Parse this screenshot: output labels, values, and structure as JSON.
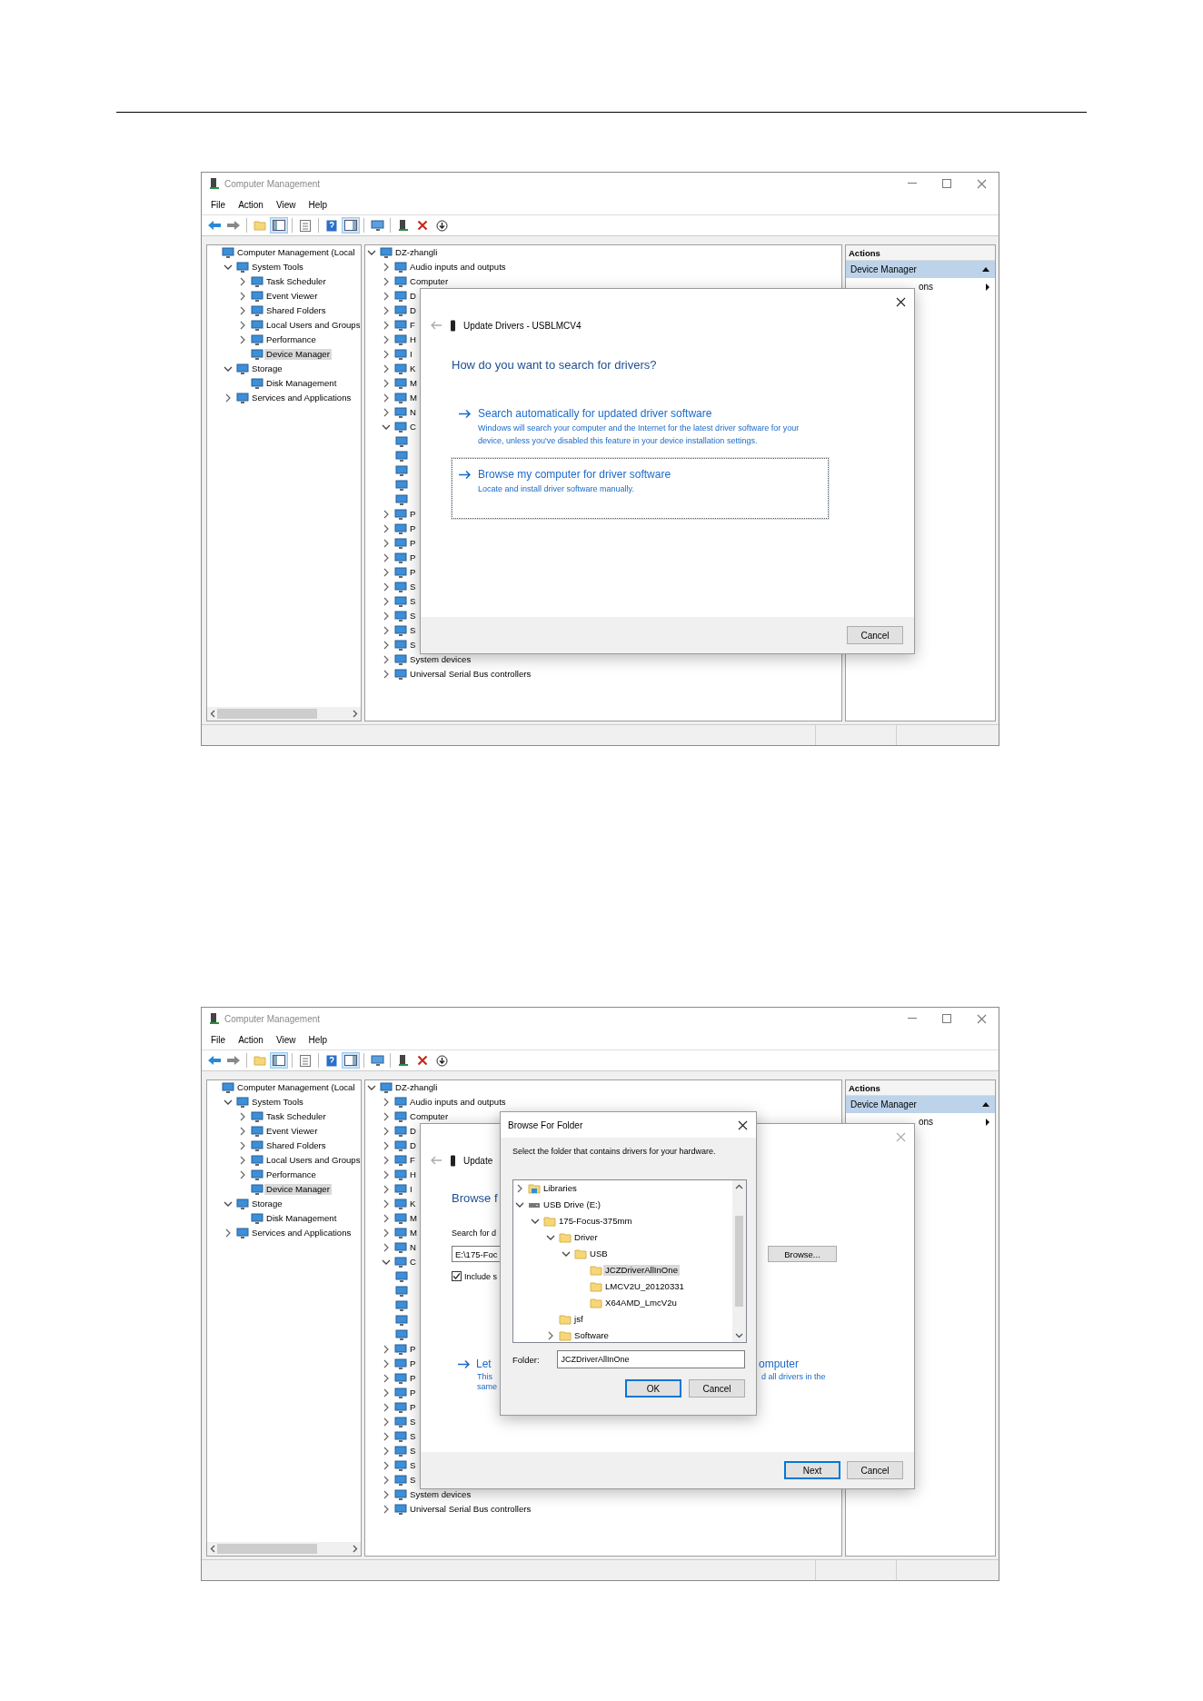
{
  "screenshots": [
    {
      "window": {
        "title": "Computer Management",
        "menu": [
          "File",
          "Action",
          "View",
          "Help"
        ],
        "toolbar": [
          {
            "pressed": false
          },
          {
            "pressed": false
          },
          {
            "pressed": false
          },
          {
            "pressed": true
          },
          {
            "pressed": false
          },
          {
            "pressed": false
          },
          {
            "pressed": true
          },
          {
            "pressed": false
          },
          {
            "pressed": false
          },
          {
            "pressed": false
          },
          {
            "pressed": false
          }
        ],
        "nav_tree": [
          {
            "label": "Computer Management (Local",
            "selected": false,
            "children": [
              {
                "label": "System Tools",
                "expanded": true,
                "selected": false,
                "children": [
                  {
                    "label": "Task Scheduler",
                    "expanded": false,
                    "selected": false
                  },
                  {
                    "label": "Event Viewer",
                    "expanded": false,
                    "selected": false
                  },
                  {
                    "label": "Shared Folders",
                    "expanded": false,
                    "selected": false
                  },
                  {
                    "label": "Local Users and Groups",
                    "expanded": false,
                    "selected": false
                  },
                  {
                    "label": "Performance",
                    "expanded": false,
                    "selected": false
                  },
                  {
                    "label": "Device Manager",
                    "selected": true
                  }
                ]
              },
              {
                "label": "Storage",
                "expanded": true,
                "selected": false,
                "children": [
                  {
                    "label": "Disk Management",
                    "selected": false
                  }
                ]
              },
              {
                "label": "Services and Applications",
                "expanded": false,
                "selected": false
              }
            ]
          }
        ],
        "device_tree": [
          {
            "label": "DZ-zhangli",
            "expanded": true,
            "children": [
              {
                "label": "Audio inputs and outputs",
                "expanded": false
              },
              {
                "label": "Computer",
                "expanded": false
              },
              {
                "label": "D",
                "expanded": false
              },
              {
                "label": "D",
                "expanded": false
              },
              {
                "label": "F",
                "expanded": false
              },
              {
                "label": "H",
                "expanded": false
              },
              {
                "label": "I",
                "expanded": false
              },
              {
                "label": "K",
                "expanded": false
              },
              {
                "label": "M",
                "expanded": false
              },
              {
                "label": "M",
                "expanded": false
              },
              {
                "label": "N",
                "expanded": false
              },
              {
                "label": "C",
                "expanded": true,
                "children": [
                  {
                    "kind": "device"
                  },
                  {
                    "kind": "device"
                  },
                  {
                    "kind": "device"
                  },
                  {
                    "kind": "device"
                  },
                  {
                    "kind": "device"
                  }
                ]
              },
              {
                "label": "P",
                "expanded": false
              },
              {
                "label": "P",
                "expanded": false
              },
              {
                "label": "P",
                "expanded": false
              },
              {
                "label": "P",
                "expanded": false
              },
              {
                "label": "P",
                "expanded": false
              },
              {
                "label": "S",
                "expanded": false
              },
              {
                "label": "S",
                "expanded": false
              },
              {
                "label": "S",
                "expanded": false
              },
              {
                "label": "S",
                "expanded": false
              },
              {
                "label": "S",
                "expanded": false
              },
              {
                "label": "System devices",
                "expanded": false
              },
              {
                "label": "Universal Serial Bus controllers",
                "expanded": false
              }
            ]
          }
        ],
        "actions": {
          "header": "Actions",
          "items": [
            {
              "label": "Device Manager",
              "kind": "section"
            },
            {
              "label": "ons",
              "kind": "submenu"
            }
          ]
        },
        "dialogs": [
          {
            "kind": "update_drivers",
            "title": "Update Drivers - USBLMCV4",
            "heading": "How do you want to search for drivers?",
            "options": [
              {
                "title": "Search automatically for updated driver software",
                "description": "Windows will search your computer and the Internet for the latest driver software for your device, unless you've disabled this feature in your device installation settings.",
                "focused": false
              },
              {
                "title": "Browse my computer for driver software",
                "description": "Locate and install driver software manually.",
                "focused": true
              }
            ],
            "buttons": [
              {
                "label": "Cancel",
                "default": false
              }
            ]
          }
        ]
      }
    },
    {
      "window": {
        "title": "Computer Management",
        "menu": [
          "File",
          "Action",
          "View",
          "Help"
        ],
        "toolbar": [
          {
            "pressed": false
          },
          {
            "pressed": false
          },
          {
            "pressed": false
          },
          {
            "pressed": true
          },
          {
            "pressed": false
          },
          {
            "pressed": false
          },
          {
            "pressed": true
          },
          {
            "pressed": false
          },
          {
            "pressed": false
          },
          {
            "pressed": false
          },
          {
            "pressed": false
          }
        ],
        "nav_tree": [
          {
            "label": "Computer Management (Local",
            "selected": false,
            "children": [
              {
                "label": "System Tools",
                "expanded": true,
                "selected": false,
                "children": [
                  {
                    "label": "Task Scheduler",
                    "expanded": false,
                    "selected": false
                  },
                  {
                    "label": "Event Viewer",
                    "expanded": false,
                    "selected": false
                  },
                  {
                    "label": "Shared Folders",
                    "expanded": false,
                    "selected": false
                  },
                  {
                    "label": "Local Users and Groups",
                    "expanded": false,
                    "selected": false
                  },
                  {
                    "label": "Performance",
                    "expanded": false,
                    "selected": false
                  },
                  {
                    "label": "Device Manager",
                    "selected": true
                  }
                ]
              },
              {
                "label": "Storage",
                "expanded": true,
                "selected": false,
                "children": [
                  {
                    "label": "Disk Management",
                    "selected": false
                  }
                ]
              },
              {
                "label": "Services and Applications",
                "expanded": false,
                "selected": false
              }
            ]
          }
        ],
        "device_tree": [
          {
            "label": "DZ-zhangli",
            "expanded": true,
            "children": [
              {
                "label": "Audio inputs and outputs",
                "expanded": false
              },
              {
                "label": "Computer",
                "expanded": false
              },
              {
                "label": "D",
                "expanded": false
              },
              {
                "label": "D",
                "expanded": false
              },
              {
                "label": "F",
                "expanded": false
              },
              {
                "label": "H",
                "expanded": false
              },
              {
                "label": "I",
                "expanded": false
              },
              {
                "label": "K",
                "expanded": false
              },
              {
                "label": "M",
                "expanded": false
              },
              {
                "label": "M",
                "expanded": false
              },
              {
                "label": "N",
                "expanded": false
              },
              {
                "label": "C",
                "expanded": true,
                "children": [
                  {
                    "kind": "device"
                  },
                  {
                    "kind": "device"
                  },
                  {
                    "kind": "device"
                  },
                  {
                    "kind": "device"
                  },
                  {
                    "kind": "device"
                  }
                ]
              },
              {
                "label": "P",
                "expanded": false
              },
              {
                "label": "P",
                "expanded": false
              },
              {
                "label": "P",
                "expanded": false
              },
              {
                "label": "P",
                "expanded": false
              },
              {
                "label": "P",
                "expanded": false
              },
              {
                "label": "S",
                "expanded": false
              },
              {
                "label": "S",
                "expanded": false
              },
              {
                "label": "S",
                "expanded": false
              },
              {
                "label": "S",
                "expanded": false
              },
              {
                "label": "S",
                "expanded": false
              },
              {
                "label": "System devices",
                "expanded": false
              },
              {
                "label": "Universal Serial Bus controllers",
                "expanded": false
              }
            ]
          }
        ],
        "actions": {
          "header": "Actions",
          "items": [
            {
              "label": "Device Manager",
              "kind": "section"
            },
            {
              "label": "ons",
              "kind": "submenu"
            }
          ]
        },
        "dialogs": [
          {
            "kind": "update_drivers_covered",
            "title": "Update",
            "heading": "Browse f",
            "search_label": "Search for d",
            "path_value": "E:\\175-Foc",
            "browse_button": "Browse...",
            "include": {
              "label": "Include s",
              "checked": true
            },
            "option": {
              "title_left": "Let",
              "title_right": "omputer",
              "description_left": [
                "This",
                "same"
              ],
              "description_right": "d all drivers in the"
            },
            "buttons": [
              {
                "label": "Next",
                "default": true
              },
              {
                "label": "Cancel",
                "default": false
              }
            ]
          },
          {
            "kind": "browse_folder",
            "title": "Browse For Folder",
            "instruction": "Select the folder that contains drivers for your hardware.",
            "tree": [
              {
                "label": "Libraries",
                "kind": "library",
                "expanded": false,
                "selected": false
              },
              {
                "label": "USB Drive (E:)",
                "kind": "drive",
                "expanded": true,
                "selected": false,
                "children": [
                  {
                    "label": "175-Focus-375mm",
                    "kind": "folder",
                    "expanded": true,
                    "selected": false,
                    "children": [
                      {
                        "label": "Driver",
                        "kind": "folder",
                        "expanded": true,
                        "selected": false,
                        "children": [
                          {
                            "label": "USB",
                            "kind": "folder",
                            "expanded": true,
                            "selected": false,
                            "children": [
                              {
                                "label": "JCZDriverAllInOne",
                                "kind": "folder",
                                "selected": true
                              },
                              {
                                "label": "LMCV2U_20120331",
                                "kind": "folder",
                                "selected": false
                              },
                              {
                                "label": "X64AMD_LmcV2u",
                                "kind": "folder",
                                "selected": false
                              }
                            ]
                          }
                        ]
                      },
                      {
                        "label": "jsf",
                        "kind": "folder",
                        "selected": false
                      },
                      {
                        "label": "Software",
                        "kind": "folder",
                        "expanded": false,
                        "selected": false
                      }
                    ]
                  }
                ]
              }
            ],
            "folder_label": "Folder:",
            "folder_value": "JCZDriverAllInOne",
            "buttons": [
              {
                "label": "OK",
                "default": true
              },
              {
                "label": "Cancel",
                "default": false
              }
            ]
          }
        ]
      }
    }
  ]
}
